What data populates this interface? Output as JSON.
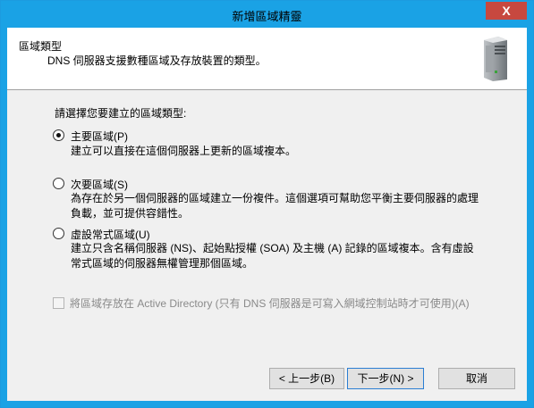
{
  "window": {
    "title": "新增區域精靈",
    "close_glyph": "X"
  },
  "header": {
    "title": "區域類型",
    "subtitle": "DNS 伺服器支援數種區域及存放裝置的類型。",
    "icon": "server-icon"
  },
  "main": {
    "prompt": "請選擇您要建立的區域類型:",
    "options": [
      {
        "label": "主要區域(P)",
        "checked": true,
        "description": [
          "建立可以直接在這個伺服器上更新的區域複本。"
        ]
      },
      {
        "label": "次要區域(S)",
        "checked": false,
        "description": [
          "為存在於另一個伺服器的區域建立一份複件。這個選項可幫助您平衡主要伺服器的處理",
          "負載，並可提供容錯性。"
        ]
      },
      {
        "label": "虛設常式區域(U)",
        "checked": false,
        "description": [
          "建立只含名稱伺服器 (NS)、起始點授權 (SOA) 及主機 (A) 記錄的區域複本。含有虛設",
          "常式區域的伺服器無權管理那個區域。"
        ]
      }
    ],
    "ad_checkbox": {
      "label": "將區域存放在 Active Directory (只有 DNS 伺服器是可寫入網域控制站時才可使用)(A)",
      "checked": false,
      "enabled": false
    }
  },
  "buttons": {
    "back": "< 上一步(B)",
    "next": "下一步(N) >",
    "cancel": "取消"
  }
}
